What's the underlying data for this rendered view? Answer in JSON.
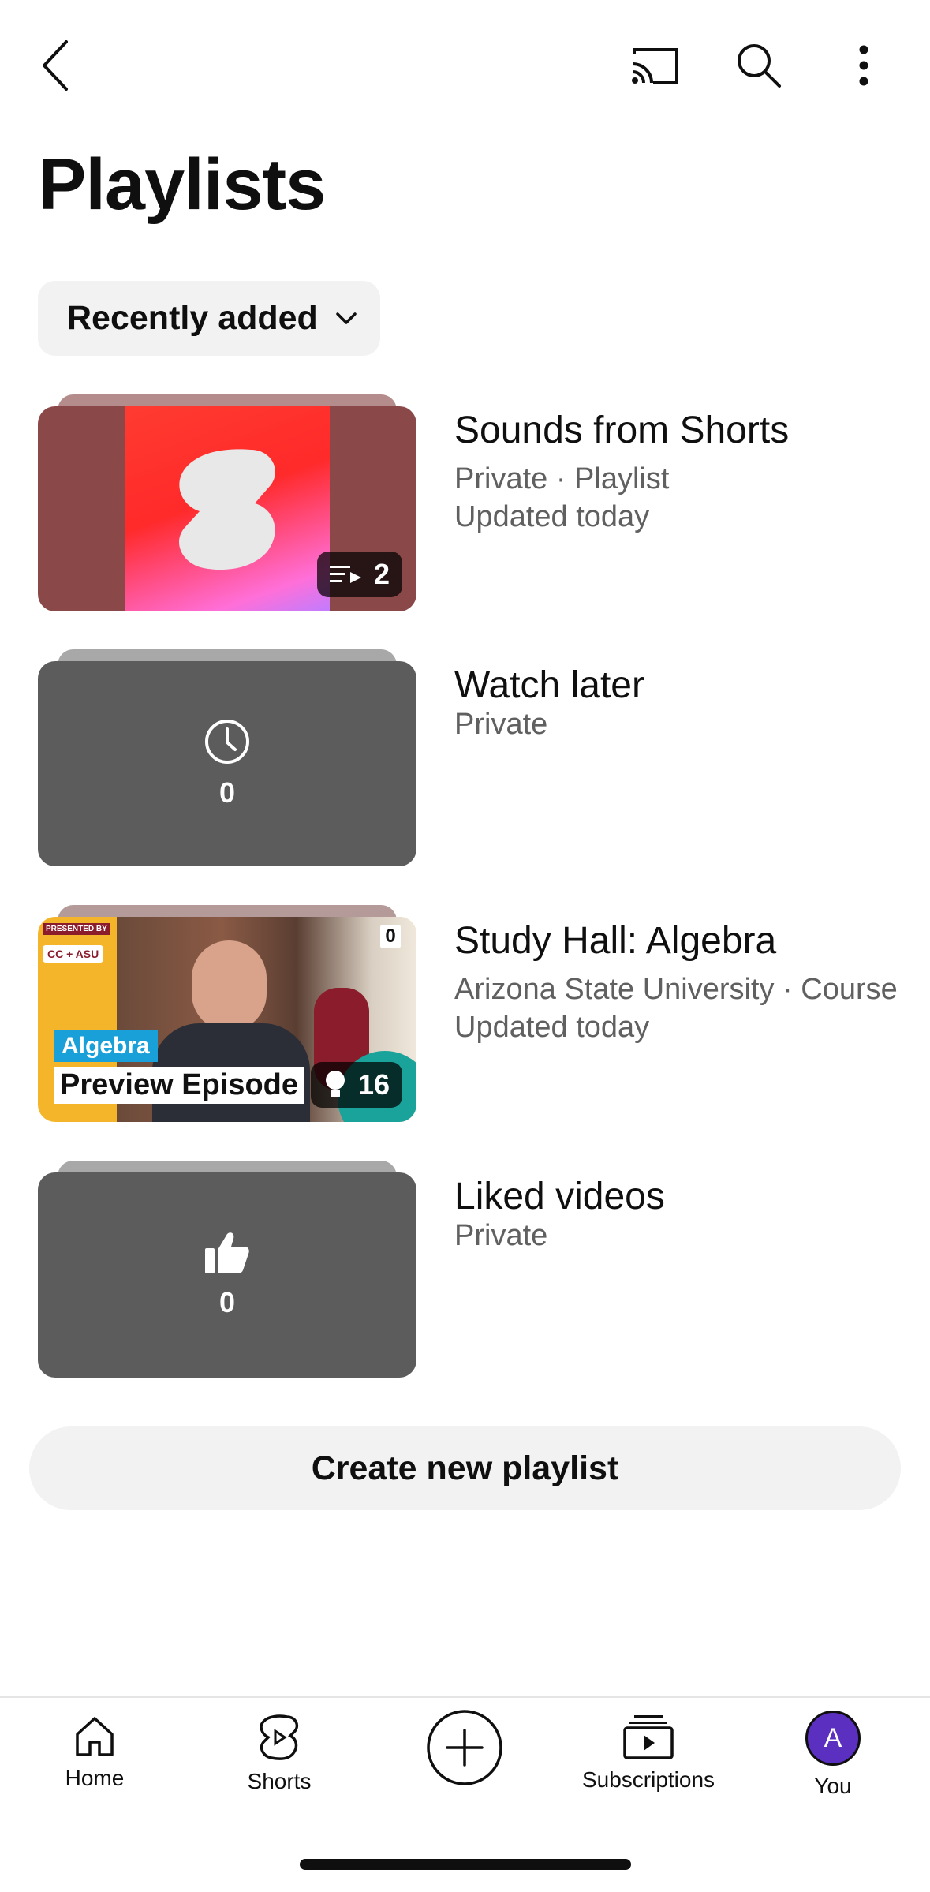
{
  "header": {
    "back_icon": "chevron-left-icon",
    "cast_icon": "cast-icon",
    "search_icon": "search-icon",
    "more_icon": "more-vertical-icon"
  },
  "page": {
    "title": "Playlists"
  },
  "sort": {
    "label": "Recently added",
    "icon": "chevron-down-icon"
  },
  "playlists": [
    {
      "title": "Sounds from Shorts",
      "meta1": "Private · Playlist",
      "meta2": "Updated today",
      "count": "2",
      "thumb_colors": [
        "#8b4848",
        "#ff3030",
        "#ff70e0"
      ]
    },
    {
      "title": "Watch later",
      "meta1": "Private",
      "meta2": "",
      "count": "0",
      "icon": "clock-icon",
      "thumb_color": "#5c5c5c"
    },
    {
      "title": "Study Hall: Algebra",
      "meta1": "Arizona State University · Course",
      "meta2": "Updated today",
      "count": "16",
      "corner_count": "0",
      "thumb_tag": "PRESENTED BY",
      "thumb_logo": "CC + ASU",
      "thumb_subject": "Algebra",
      "thumb_caption": "Preview Episode"
    },
    {
      "title": "Liked videos",
      "meta1": "Private",
      "meta2": "",
      "count": "0",
      "icon": "thumbs-up-icon",
      "thumb_color": "#5c5c5c"
    }
  ],
  "create_button": {
    "label": "Create new playlist"
  },
  "bottom_nav": [
    {
      "label": "Home",
      "icon": "home-icon"
    },
    {
      "label": "Shorts",
      "icon": "shorts-icon"
    },
    {
      "label": "",
      "icon": "create-plus-icon"
    },
    {
      "label": "Subscriptions",
      "icon": "subscriptions-icon"
    },
    {
      "label": "You",
      "icon": "avatar",
      "avatar_letter": "A",
      "avatar_color": "#5b2fbf"
    }
  ]
}
